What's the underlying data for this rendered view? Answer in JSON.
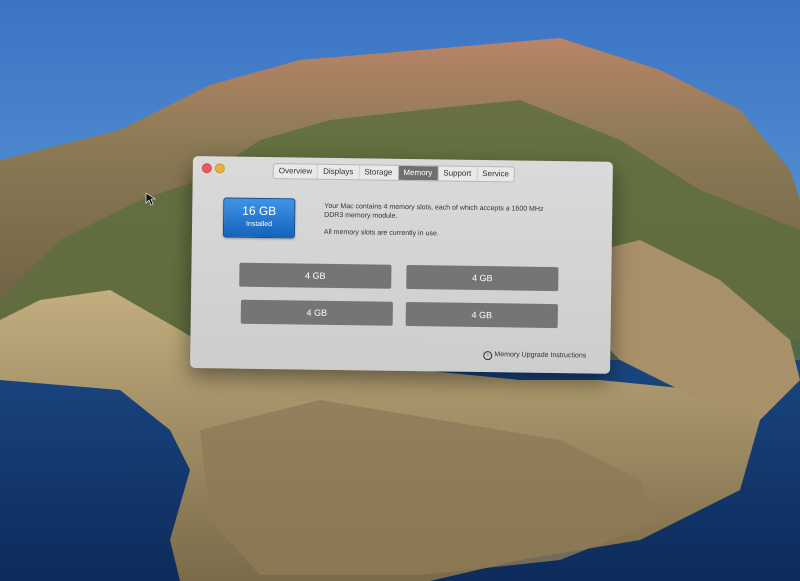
{
  "window": {
    "tabs": [
      {
        "label": "Overview"
      },
      {
        "label": "Displays"
      },
      {
        "label": "Storage"
      },
      {
        "label": "Memory"
      },
      {
        "label": "Support"
      },
      {
        "label": "Service"
      }
    ],
    "active_tab": "Memory"
  },
  "memory": {
    "installed_size": "16 GB",
    "installed_label": "Installed",
    "description_line1": "Your Mac contains 4 memory slots, each of which accepts a 1600 MHz DDR3 memory module.",
    "description_line2": "All memory slots are currently in use.",
    "slots": [
      {
        "label": "4 GB"
      },
      {
        "label": "4 GB"
      },
      {
        "label": "4 GB"
      },
      {
        "label": "4 GB"
      }
    ],
    "upgrade_link": "Memory Upgrade Instructions"
  },
  "colors": {
    "badge_blue": "#1f74d1",
    "slot_gray": "#757575",
    "active_tab_gray": "#6f6f6f"
  }
}
